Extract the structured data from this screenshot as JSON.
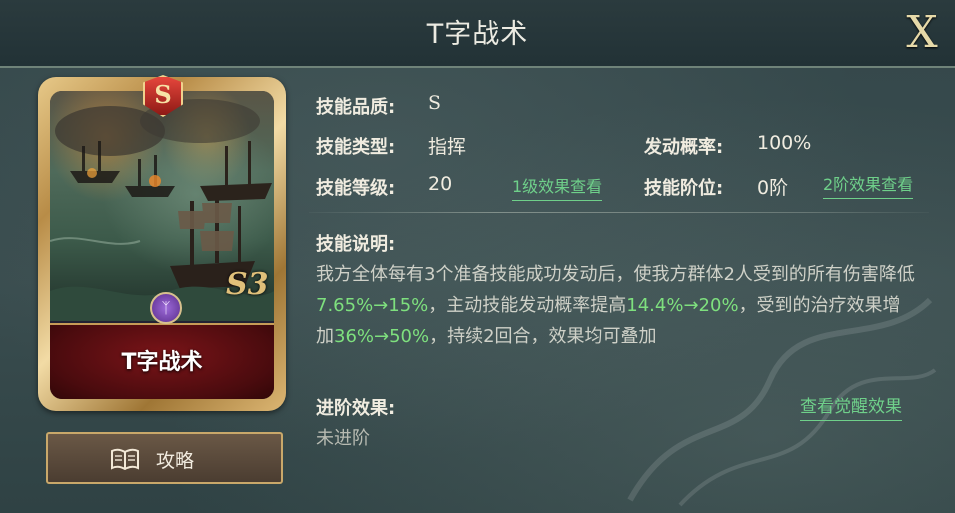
{
  "header": {
    "title": "T字战术",
    "close_label": "X"
  },
  "card": {
    "rank": "S",
    "name": "T字战术",
    "season_mark": "S3",
    "type_icon": "command-icon",
    "type_glyph": "ᛉ"
  },
  "guide_button": {
    "label": "攻略",
    "icon": "book-icon"
  },
  "info": {
    "quality_label": "技能品质:",
    "quality_value": "S",
    "type_label": "技能类型:",
    "type_value": "指挥",
    "rate_label": "发动概率:",
    "rate_value": "100%",
    "level_label": "技能等级:",
    "level_value": "20",
    "level1_link": "1级效果查看",
    "stage_label": "技能阶位:",
    "stage_value": "0阶",
    "stage2_link": "2阶效果查看"
  },
  "description": {
    "label": "技能说明:",
    "part1": "我方全体每有3个准备技能成功发动后，使我方群体2人受到的所有伤害降低",
    "hl1": "7.65%→15%",
    "part2": "，主动技能发动概率提高",
    "hl2": "14.4%→20%",
    "part3": "，受到的治疗效果增加",
    "hl3": "36%→50%",
    "part4": "，持续2回合，效果均可叠加"
  },
  "advance": {
    "label": "进阶效果:",
    "link": "查看觉醒效果",
    "value": "未进阶"
  },
  "colors": {
    "highlight": "#7ee07e",
    "link": "#6fd08a",
    "card_frame": "#c9a86a"
  }
}
